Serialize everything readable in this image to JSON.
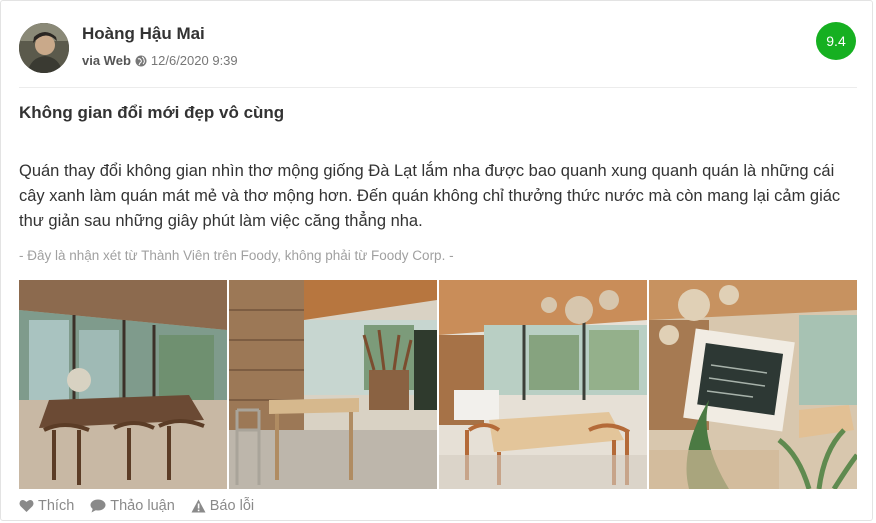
{
  "review": {
    "author": "Hoàng Hậu Mai",
    "via": "via Web",
    "datetime": "12/6/2020 9:39",
    "score": "9.4",
    "title": "Không gian đổi mới đẹp vô cùng",
    "body": "Quán thay đổi không gian nhìn thơ mộng giống Đà Lạt lắm nha được bao quanh xung quanh quán là những cái cây xanh làm quán mát mẻ và thơ mộng hơn. Đến quán không chỉ thưởng thức nước mà còn mang lại cảm giác thư giản sau những giây phút làm việc căng thẳng nha.",
    "disclaimer": "- Đây là nhận xét từ Thành Viên trên Foody, không phải từ Foody Corp. -"
  },
  "actions": {
    "like": "Thích",
    "discuss": "Thảo luận",
    "report": "Báo lỗi"
  },
  "icons": {
    "globe": "globe-icon",
    "like": "heart-icon",
    "discuss": "comment-icon",
    "report": "warning-icon"
  },
  "colors": {
    "score_badge": "#16b021",
    "disclaimer": "#a0a0a0",
    "action": "#8a8a8a"
  }
}
